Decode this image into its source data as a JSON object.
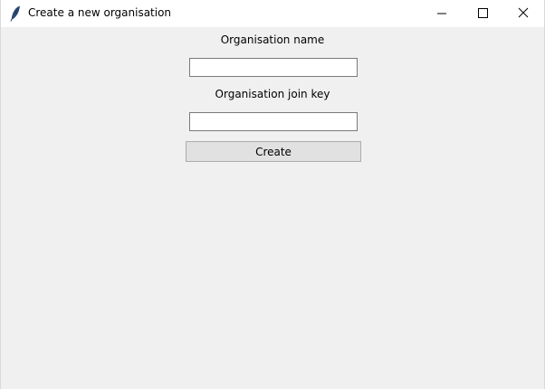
{
  "window": {
    "title": "Create a new organisation",
    "icon": "feather-icon",
    "controls": [
      "minimize-icon",
      "maximize-icon",
      "close-icon"
    ]
  },
  "form": {
    "name_label": "Organisation name",
    "name_value": "",
    "key_label": "Organisation join key",
    "key_value": "",
    "create_label": "Create"
  },
  "colors": {
    "window_bg": "#f0f0f0",
    "titlebar_bg": "#ffffff",
    "button_bg": "#e1e1e1",
    "button_border": "#adadad",
    "entry_border": "#7a7a7a"
  }
}
